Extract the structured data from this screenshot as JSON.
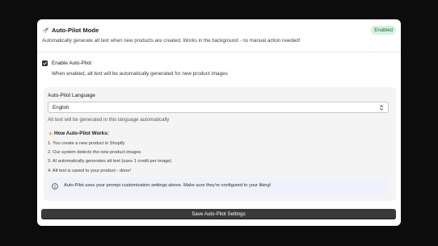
{
  "header": {
    "icon": "rocket-icon",
    "title": "Auto-Pilot Mode",
    "status_badge": "Enabled",
    "description": "Automatically generate alt text when new products are created. Works in the background - no manual action needed!"
  },
  "auto_pilot": {
    "checked": true,
    "label": "Enable Auto-Pilot",
    "help": "When enabled, alt text will be automatically generated for new product images"
  },
  "language": {
    "label": "Auto-Pilot Language",
    "selected": "English",
    "help": "Alt text will be generated in this language automatically"
  },
  "how_it_works": {
    "icon": "sparkle-icon",
    "title": "How Auto-Pilot Works:",
    "steps": [
      "1. You create a new product in Shopify",
      "2. Our system detects the new product images",
      "3. AI automatically generates alt text (uses 1 credit per image)",
      "4. Alt text is saved to your product - done!"
    ]
  },
  "info": {
    "icon": "info-icon",
    "text": "Auto-Pilot uses your prompt customization settings above. Make sure they're configured to your liking!"
  },
  "actions": {
    "save_label": "Save Auto-Pilot Settings"
  },
  "colors": {
    "badge_bg": "#d3f3dc",
    "badge_text": "#216c39",
    "button_bg": "#3a3a3a",
    "info_bg": "#eef2fb"
  }
}
